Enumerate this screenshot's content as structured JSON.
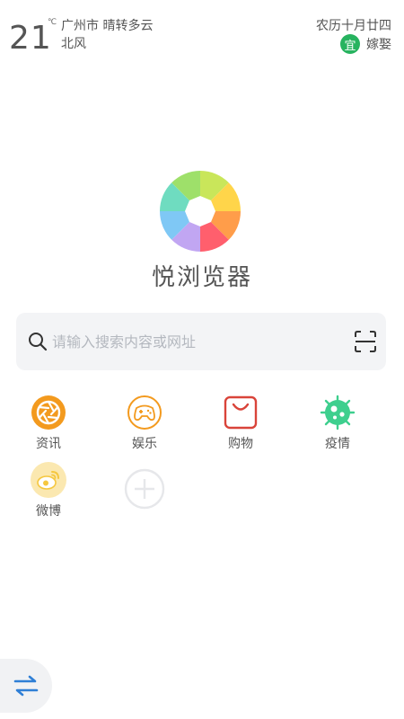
{
  "header": {
    "temperature": "21",
    "temperature_unit": "℃",
    "city_weather": "广州市 晴转多云",
    "wind": "北风",
    "lunar_date": "农历十月廿四",
    "yi_label": "宜",
    "yi_text": "嫁娶",
    "yi_color": "#27b35f"
  },
  "app": {
    "title": "悦浏览器"
  },
  "search": {
    "placeholder": "请输入搜索内容或网址",
    "value": ""
  },
  "shortcuts": [
    {
      "label": "资讯",
      "icon": "aperture-icon",
      "color": "#f39a1e"
    },
    {
      "label": "娱乐",
      "icon": "gamepad-icon",
      "color": "#f39a1e"
    },
    {
      "label": "购物",
      "icon": "shopping-bag-icon",
      "color": "#d9443a"
    },
    {
      "label": "疫情",
      "icon": "virus-icon",
      "color": "#3ecf8e"
    },
    {
      "label": "微博",
      "icon": "weibo-icon",
      "color": "#f5c73f"
    }
  ],
  "colors": {
    "accent_blue": "#2f7fd6",
    "search_bg": "#f3f4f6"
  }
}
